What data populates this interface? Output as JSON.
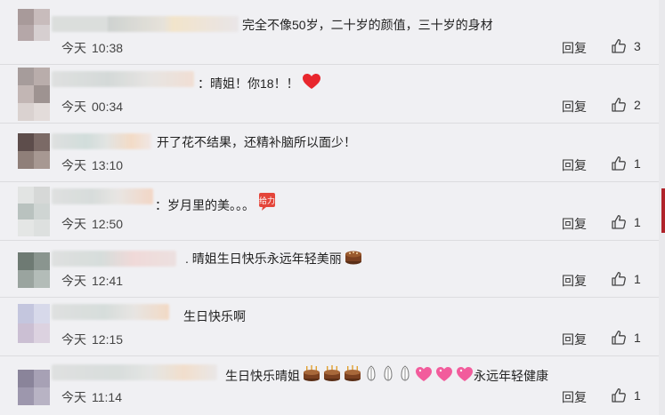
{
  "labels": {
    "reply": "回复",
    "today": "今天"
  },
  "colors": {
    "heart": "#e8262d",
    "background": "#f0f0f3",
    "accent": "#b0232a"
  },
  "comments": [
    {
      "text": "完全不像50岁，二十岁的颜值，三十岁的身材",
      "emoji": "",
      "time": "10:38",
      "likes": "3"
    },
    {
      "text": "：晴姐！你18！！",
      "emoji": "red-heart",
      "time": "00:34",
      "likes": "2"
    },
    {
      "text": "开了花不结果，还精补脑所以面少！",
      "emoji": "",
      "time": "13:10",
      "likes": "1"
    },
    {
      "text": "：岁月里的美。。。",
      "emoji": "jiayou-sticker",
      "emoji_text": "给力",
      "time": "12:50",
      "likes": "1"
    },
    {
      "text": ". 晴姐生日快乐永远年轻美丽",
      "emoji": "cake",
      "time": "12:41",
      "likes": "1"
    },
    {
      "text": "生日快乐啊",
      "emoji": "",
      "time": "12:15",
      "likes": "1"
    },
    {
      "text_a": "生日快乐晴姐",
      "text_b": "永远年轻健康",
      "emoji": "cakes-hands-hearts",
      "time": "11:14",
      "likes": "1"
    }
  ]
}
